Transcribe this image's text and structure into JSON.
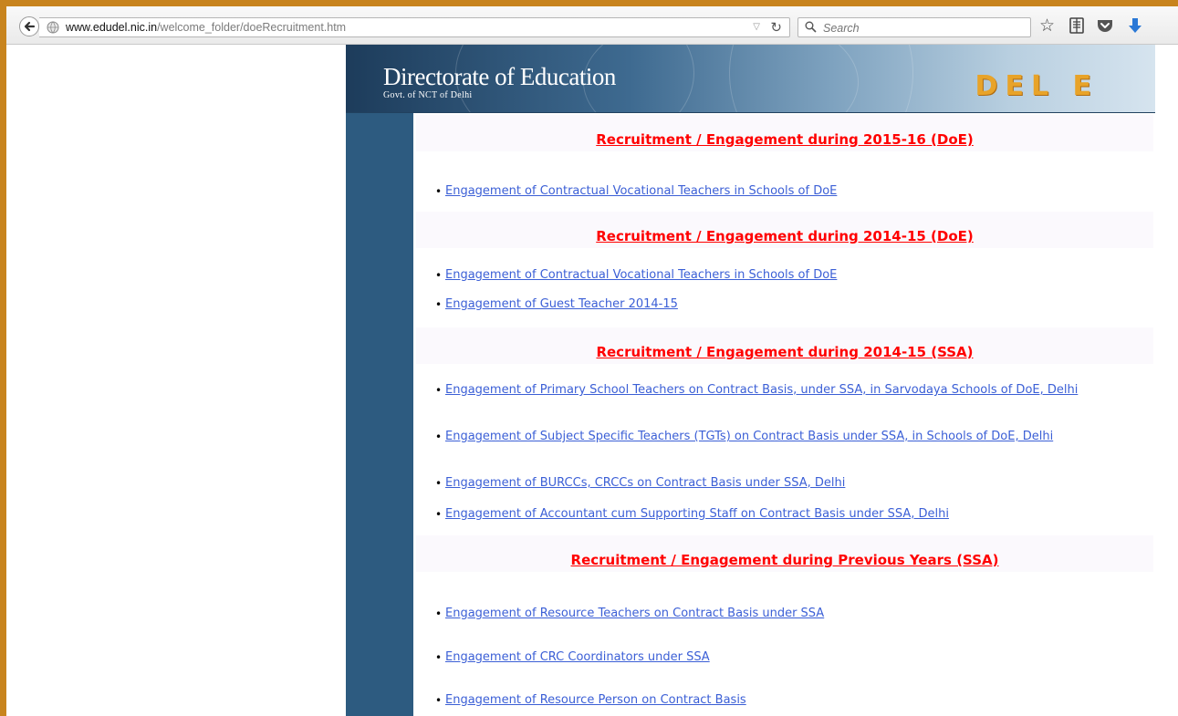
{
  "browser": {
    "url_domain": "www.edudel.nic.in",
    "url_path": "/welcome_folder/doeRecruitment.htm",
    "search_placeholder": "Search",
    "icons": [
      "back-icon",
      "globe-icon",
      "dropdown-icon",
      "reload-icon",
      "search-icon",
      "star-icon",
      "reader-icon",
      "pocket-icon",
      "download-icon"
    ]
  },
  "header": {
    "title": "Directorate of Education",
    "subtitle": "Govt. of NCT of Delhi",
    "logo_text": "DEL E"
  },
  "colors": {
    "sidebar": "#2d5b80",
    "section_heading": "#ff0000",
    "link": "#3b5fd6",
    "frame": "#c8841e"
  },
  "sections": [
    {
      "heading": "Recruitment / Engagement during 2015-16 (DoE)",
      "items": [
        "Engagement of Contractual Vocational Teachers in Schools of DoE"
      ]
    },
    {
      "heading": "Recruitment / Engagement during 2014-15 (DoE)",
      "items": [
        "Engagement of Contractual Vocational Teachers in Schools of DoE",
        "Engagement of Guest Teacher 2014-15"
      ]
    },
    {
      "heading": "Recruitment / Engagement during 2014-15 (SSA)",
      "items": [
        "Engagement of Primary School Teachers on Contract Basis, under SSA, in Sarvodaya Schools of DoE, Delhi",
        "Engagement of Subject Specific Teachers (TGTs) on Contract Basis under SSA, in Schools of DoE, Delhi",
        "Engagement of BURCCs, CRCCs on Contract Basis under SSA, Delhi",
        "Engagement of Accountant cum Supporting Staff on Contract Basis under SSA, Delhi"
      ]
    },
    {
      "heading": "Recruitment / Engagement during Previous Years (SSA)",
      "items": [
        "Engagement of Resource Teachers on Contract Basis under SSA",
        "Engagement of CRC Coordinators under SSA",
        "Engagement of Resource Person on Contract Basis"
      ]
    }
  ]
}
